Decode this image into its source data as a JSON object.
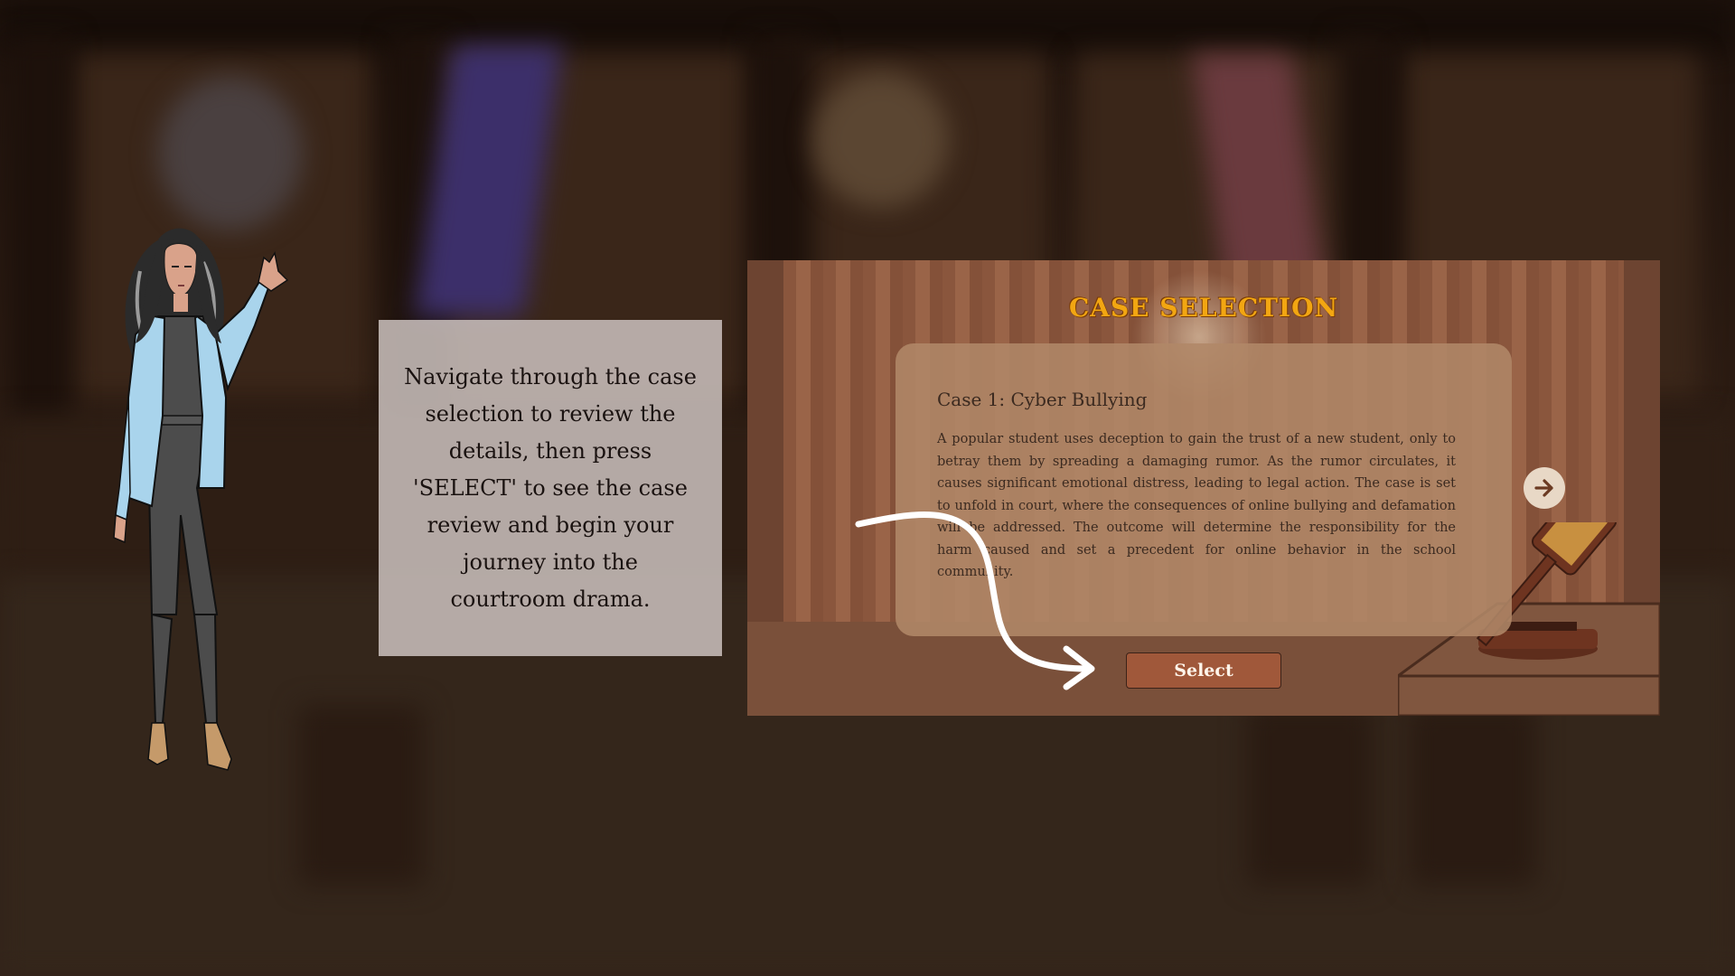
{
  "instruction": {
    "text": "Navigate through the case selection to review the details, then press 'SELECT' to see the case review and begin your journey into the courtroom drama."
  },
  "case_selection": {
    "title": "CASE SELECTION",
    "case": {
      "name": "Case 1: Cyber Bullying",
      "description": "A popular student uses deception to gain the trust of a new student, only to betray them by spreading a damaging rumor. As the rumor circulates, it causes significant emotional distress, leading to legal action. The case is set to unfold in court, where the consequences of online bullying and defamation will be addressed. The outcome will determine the responsibility for the harm caused and set a precedent for online behavior in the school community."
    },
    "select_label": "Select",
    "next_icon": "arrow-right-icon"
  },
  "colors": {
    "title": "#f2a612",
    "select_button": "#a0583a",
    "panel": "#7a4f39",
    "card": "#b08868",
    "instruction_box": "#c7bdba"
  }
}
